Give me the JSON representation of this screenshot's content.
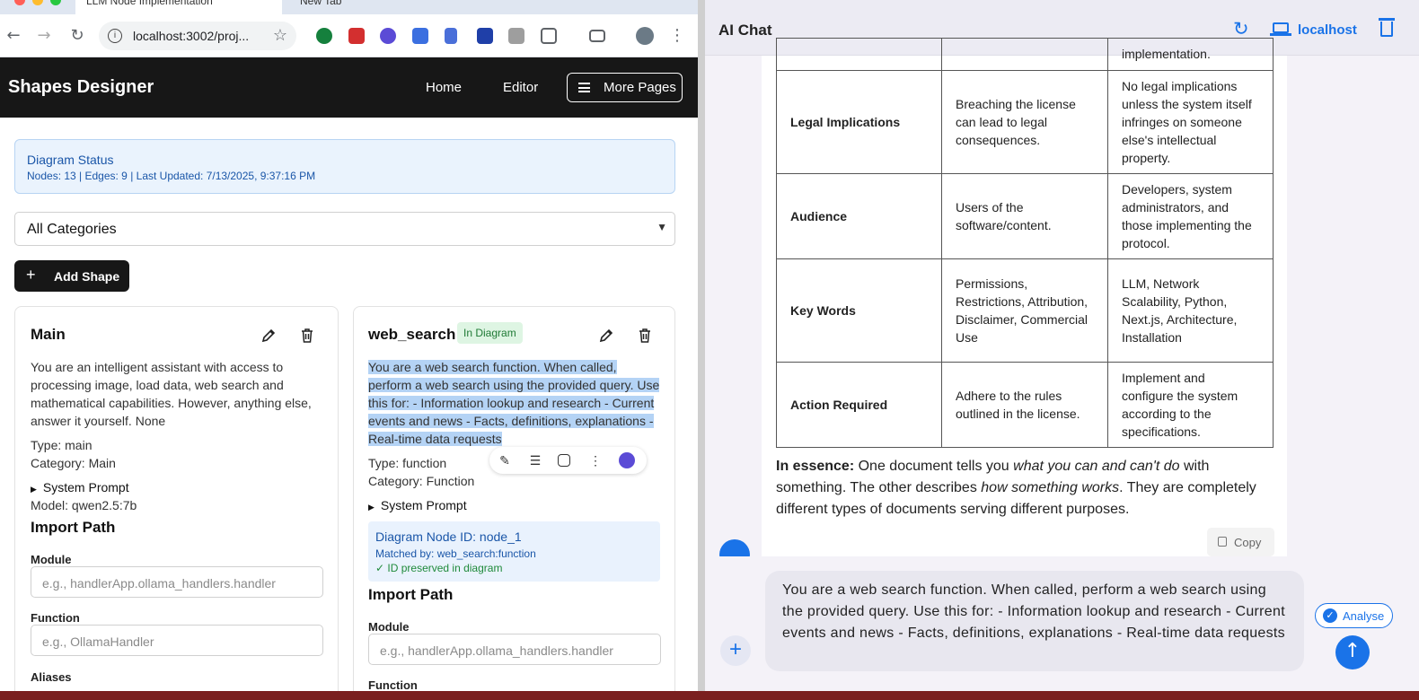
{
  "browser": {
    "tabs": [
      {
        "label": "LLM Node Implementation"
      },
      {
        "label": "New Tab"
      }
    ],
    "url": "localhost:3002/proj..."
  },
  "app": {
    "brand": "Shapes Designer",
    "nav": {
      "home": "Home",
      "editor": "Editor",
      "more": "More Pages"
    },
    "status": {
      "title": "Diagram Status",
      "details": "Nodes: 13 | Edges: 9 | Last Updated: 7/13/2025, 9:37:16 PM"
    },
    "category_select": "All Categories",
    "add_shape": "Add Shape",
    "cards": [
      {
        "title": "Main",
        "description": "You are an intelligent assistant with access to processing image, load data, web search and mathematical capabilities. However, anything else, answer it yourself. None",
        "type": "Type: main",
        "category": "Category: Main",
        "system_prompt": "System Prompt",
        "model": "Model: qwen2.5:7b",
        "import_heading": "Import Path",
        "module_label": "Module",
        "module_placeholder": "e.g., handlerApp.ollama_handlers.handler",
        "function_label": "Function",
        "function_placeholder": "e.g., OllamaHandler",
        "aliases_label": "Aliases"
      },
      {
        "title": "web_search",
        "badge": "In Diagram",
        "description": "You are a web search function. When called, perform a web search using the provided query. Use this for: - Information lookup and research - Current events and news - Facts, definitions, explanations - Real-time data requests",
        "type": "Type: function",
        "category": "Category: Function",
        "system_prompt": "System Prompt",
        "diagram_node": "Diagram Node ID: node_1",
        "matched_by": "Matched by: web_search:function",
        "preserved": "✓ ID preserved in diagram",
        "import_heading": "Import Path",
        "module_label": "Module",
        "module_placeholder": "e.g., handlerApp.ollama_handlers.handler",
        "function_label": "Function"
      }
    ]
  },
  "chat": {
    "title": "AI Chat",
    "host": "localhost",
    "table": {
      "partial_row": {
        "c3": "implementation."
      },
      "rows": [
        {
          "key": "Legal Implications",
          "a": "Breaching the license can lead to legal consequences.",
          "b": "No legal implications unless the system itself infringes on someone else's intellectual property."
        },
        {
          "key": "Audience",
          "a": "Users of the software/content.",
          "b": "Developers, system administrators, and those implementing the protocol."
        },
        {
          "key": "Key Words",
          "a": "Permissions, Restrictions, Attribution, Disclaimer, Commercial Use",
          "b": "LLM, Network Scalability, Python, Next.js, Architecture, Installation"
        },
        {
          "key": "Action Required",
          "a": "Adhere to the rules outlined in the license.",
          "b": "Implement and configure the system according to the specifications."
        }
      ]
    },
    "essence": {
      "lead": "In essence:",
      "t1": " One document tells you ",
      "e1": "what you can and can't do",
      "t2": " with something. The other describes ",
      "e2": "how something works",
      "t3": ". They are completely different types of documents serving different purposes."
    },
    "copy": "Copy",
    "input_text": "You are a web search function. When called, perform a web search using the provided query. Use this for: - Information lookup and research - Current events and news - Facts, definitions, explanations - Real-time data requests",
    "analyse": "Analyse"
  },
  "colors": {
    "accent": "#1a73e8",
    "navbar": "#171717",
    "selection": "#b4d3f5",
    "badge_bg": "#def5e3"
  }
}
